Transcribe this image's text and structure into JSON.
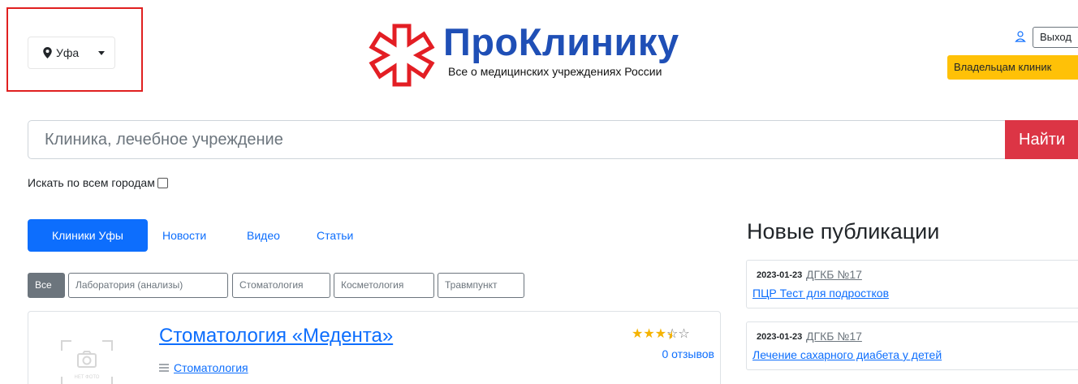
{
  "header": {
    "city": "Уфа",
    "logo_brand": "ПроКлинику",
    "logo_tagline": "Все о медицинских учреждениях России",
    "logout_label": "Выход",
    "owners_label": "Владельцам клиник",
    "logo_color": "#1f4fb6",
    "mark_color": "#e31e24"
  },
  "search": {
    "placeholder": "Клиника, лечебное учреждение",
    "button_label": "Найти",
    "all_cities_label": "Искать по всем городам",
    "all_cities_checked": false
  },
  "tabs": [
    {
      "label": "Клиники Уфы",
      "active": true
    },
    {
      "label": "Новости",
      "active": false
    },
    {
      "label": "Видео",
      "active": false
    },
    {
      "label": "Статьи",
      "active": false
    }
  ],
  "filters": [
    {
      "label": "Все",
      "active": true
    },
    {
      "label": "Лаборатория (анализы)",
      "active": false
    },
    {
      "label": "Стоматология",
      "active": false
    },
    {
      "label": "Косметология",
      "active": false
    },
    {
      "label": "Травмпункт",
      "active": false
    }
  ],
  "clinic": {
    "title": "Стоматология «Медента»",
    "category": "Стоматология",
    "rating": 3.5,
    "rating_max": 5,
    "reviews": "0 отзывов",
    "photo_placeholder": "НЕТ ФОТО"
  },
  "sidebar": {
    "title": "Новые публикации",
    "publications": [
      {
        "date": "2023-01-23",
        "source": "ДГКБ №17",
        "title": "ПЦР Тест для подростков"
      },
      {
        "date": "2023-01-23",
        "source": "ДГКБ №17",
        "title": "Лечение сахарного диабета у детей"
      }
    ]
  }
}
